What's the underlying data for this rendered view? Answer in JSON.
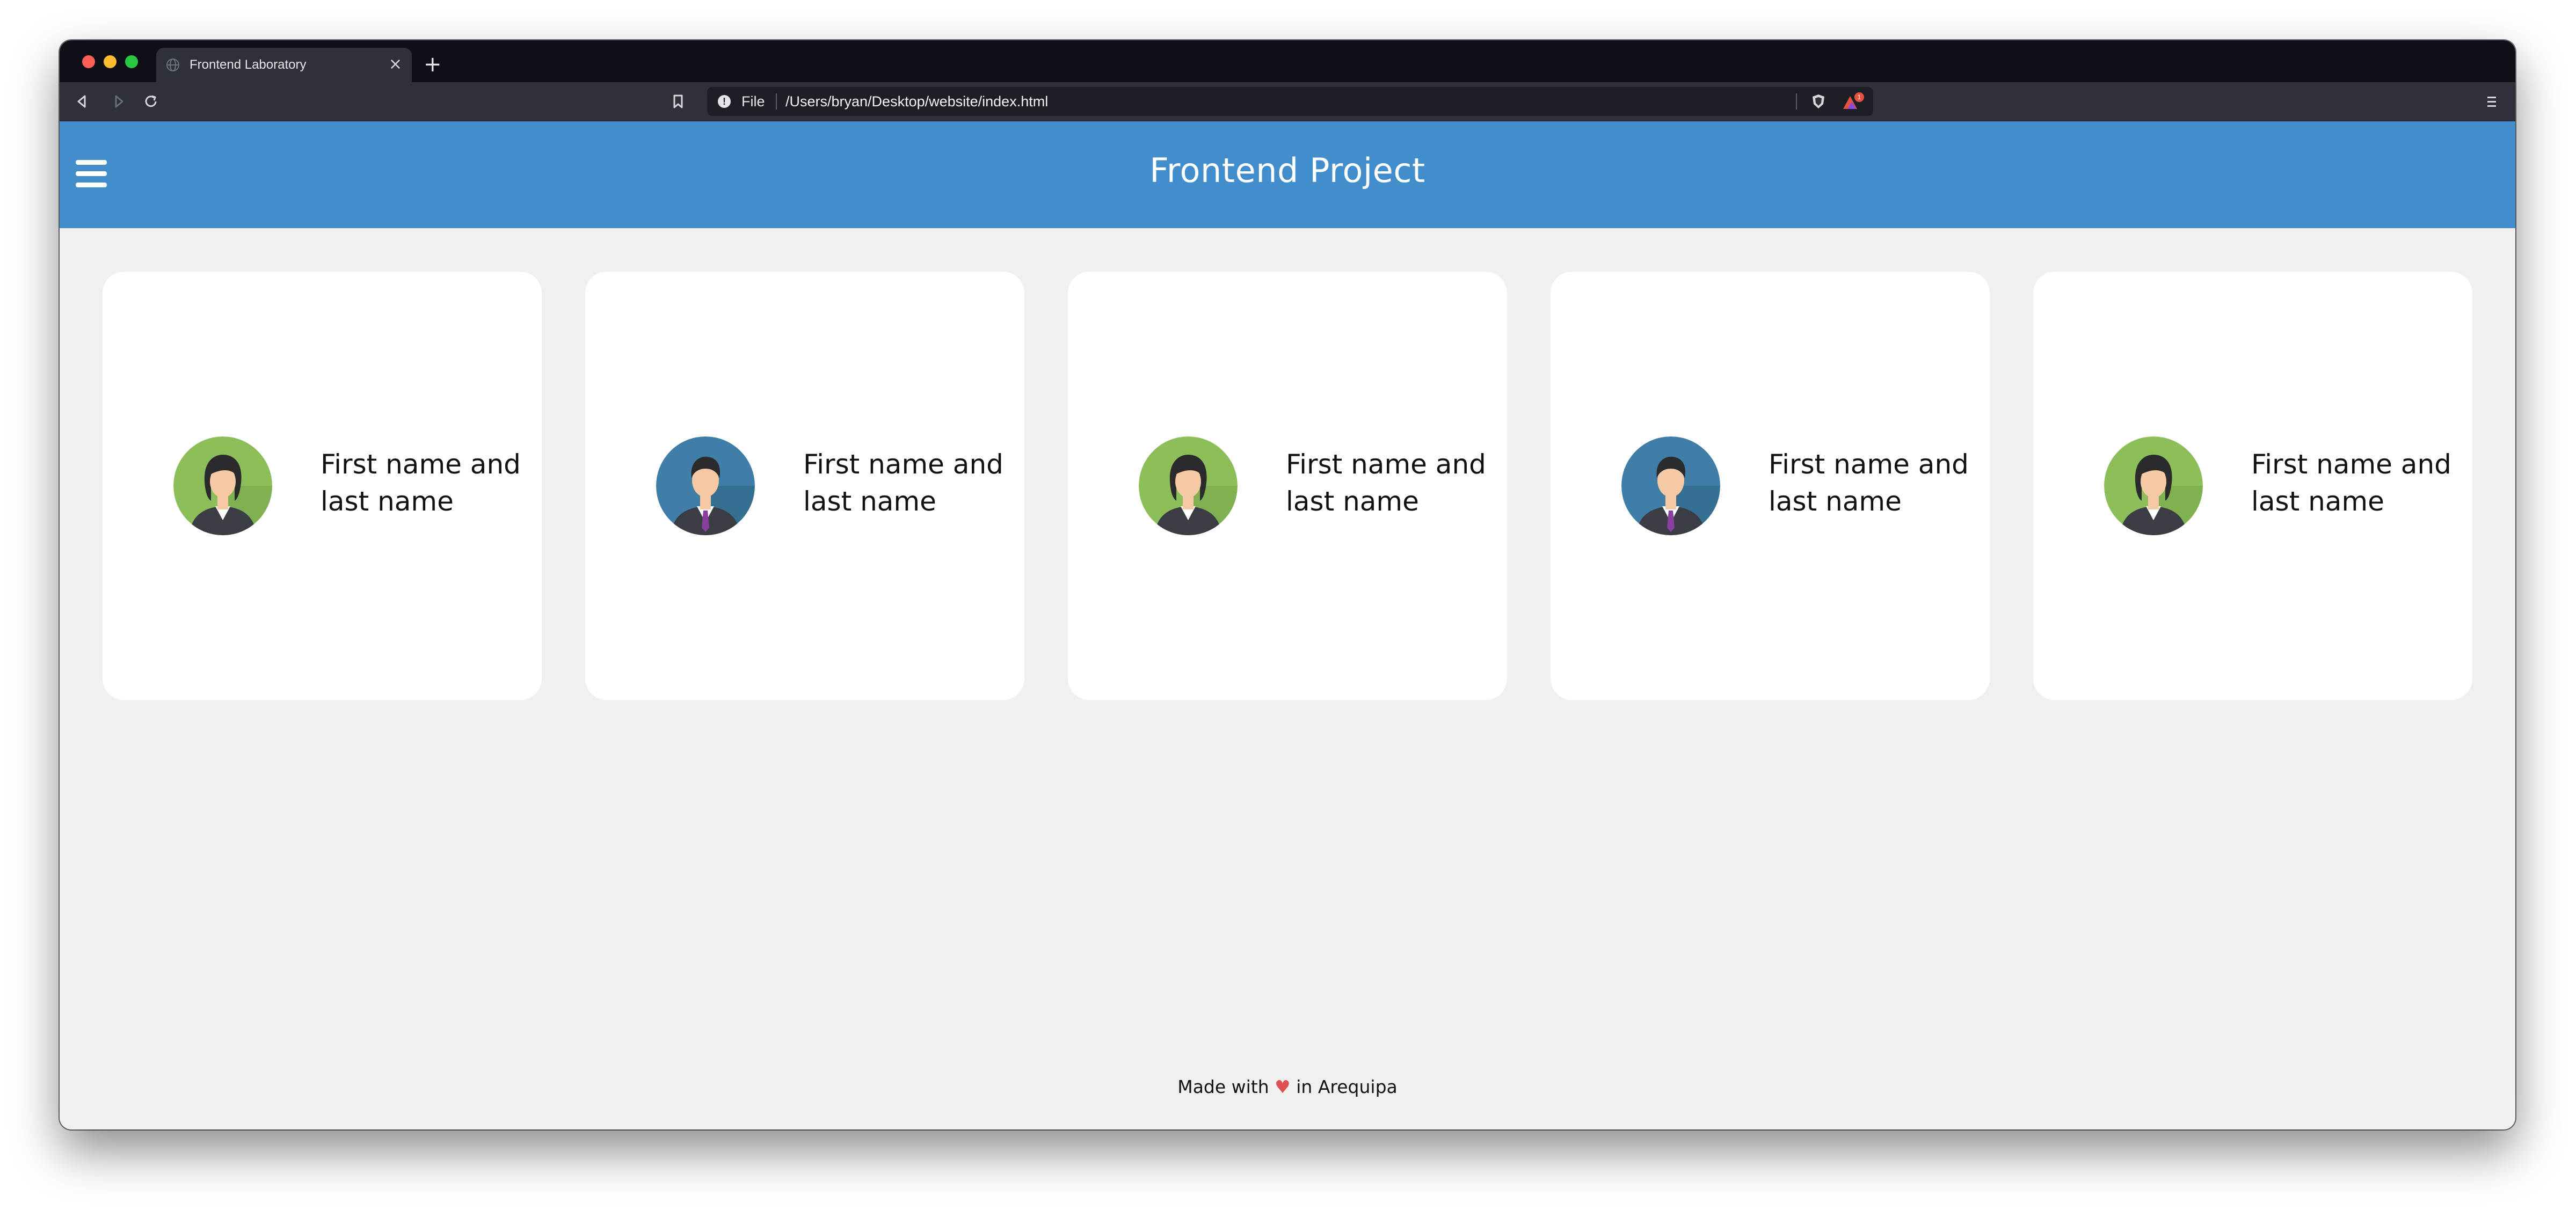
{
  "browser": {
    "tab_title": "Frontend Laboratory",
    "tab_close_label": "×",
    "new_tab_label": "+",
    "url_scheme": "File",
    "url_path": "/Users/bryan/Desktop/website/index.html",
    "rewards_badge": "1"
  },
  "header": {
    "title": "Frontend Project",
    "menu_icon": "hamburger-icon",
    "background_color": "#428dcb"
  },
  "cards": [
    {
      "name": "First name and last name",
      "avatar": "female-avatar"
    },
    {
      "name": "First name and last name",
      "avatar": "male-avatar"
    },
    {
      "name": "First name and last name",
      "avatar": "female-avatar"
    },
    {
      "name": "First name and last name",
      "avatar": "male-avatar"
    },
    {
      "name": "First name and last name",
      "avatar": "female-avatar"
    }
  ],
  "footer": {
    "prefix": "Made with",
    "heart": "♥",
    "suffix": "in Arequipa"
  }
}
